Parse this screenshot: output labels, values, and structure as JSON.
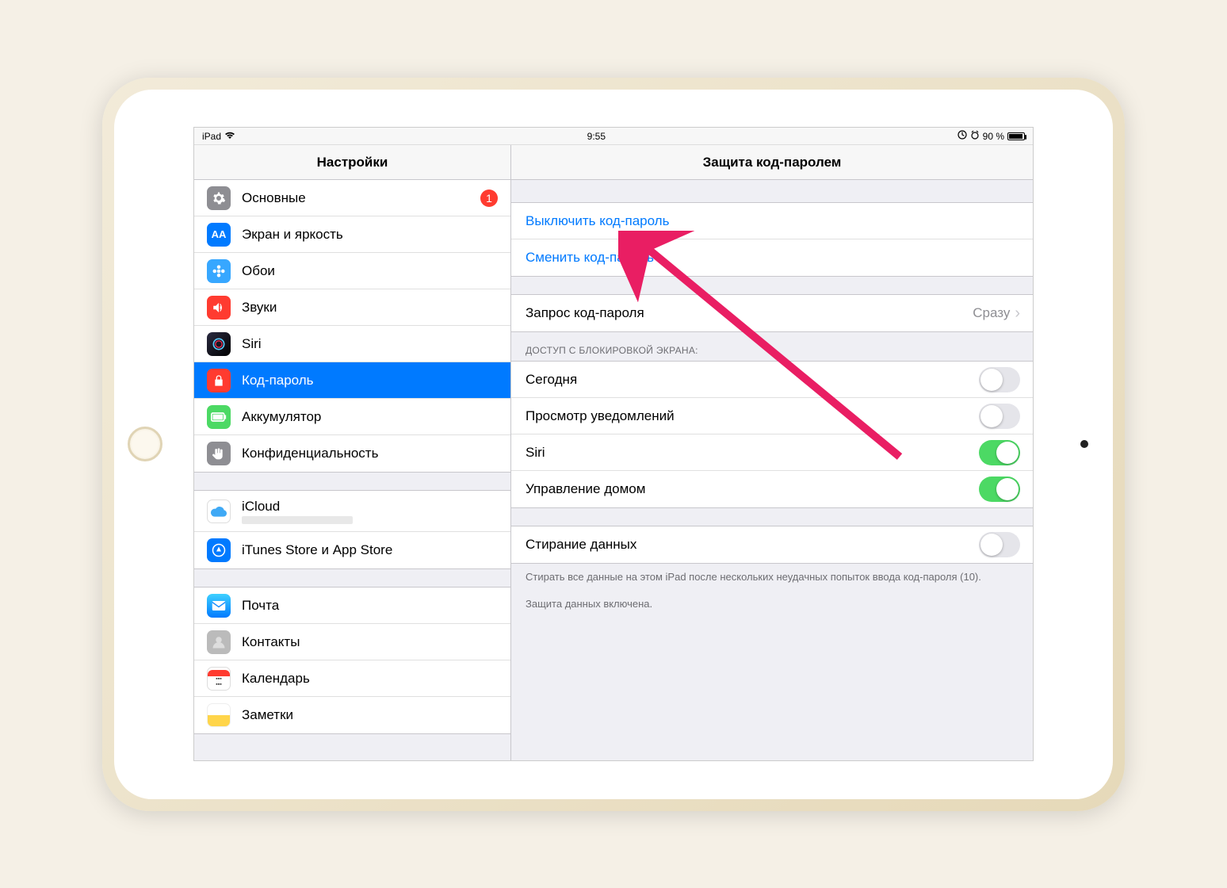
{
  "statusbar": {
    "device": "iPad",
    "time": "9:55",
    "battery_pct": "90 %"
  },
  "sidebar": {
    "title": "Настройки",
    "groups": [
      {
        "items": [
          {
            "id": "general",
            "label": "Основные",
            "badge": "1",
            "icon": "gear",
            "color": "icon-gray"
          },
          {
            "id": "display",
            "label": "Экран и яркость",
            "icon": "AA",
            "color": "icon-blue"
          },
          {
            "id": "wallpaper",
            "label": "Обои",
            "icon": "flower",
            "color": "icon-blue-dark"
          },
          {
            "id": "sounds",
            "label": "Звуки",
            "icon": "speaker",
            "color": "icon-red"
          },
          {
            "id": "siri",
            "label": "Siri",
            "icon": "siri",
            "color": "icon-grad"
          },
          {
            "id": "passcode",
            "label": "Код-пароль",
            "icon": "lock",
            "color": "icon-red",
            "selected": true
          },
          {
            "id": "battery",
            "label": "Аккумулятор",
            "icon": "battery",
            "color": "icon-green"
          },
          {
            "id": "privacy",
            "label": "Конфиденциальность",
            "icon": "hand",
            "color": "icon-gray"
          }
        ]
      },
      {
        "items": [
          {
            "id": "icloud",
            "label": "iCloud",
            "sub": "",
            "icon": "cloud",
            "color": "icon-white"
          },
          {
            "id": "itunes",
            "label": "iTunes Store и App Store",
            "icon": "appstore",
            "color": "icon-blue"
          }
        ]
      },
      {
        "items": [
          {
            "id": "mail",
            "label": "Почта",
            "icon": "mail",
            "color": "icon-blue"
          },
          {
            "id": "contacts",
            "label": "Контакты",
            "icon": "contacts",
            "color": "icon-gray"
          },
          {
            "id": "calendar",
            "label": "Календарь",
            "icon": "calendar",
            "color": "icon-white"
          },
          {
            "id": "notes",
            "label": "Заметки",
            "icon": "notes",
            "color": "icon-yellow"
          }
        ]
      }
    ]
  },
  "detail": {
    "title": "Защита код-паролем",
    "actions": {
      "turn_off": "Выключить код-пароль",
      "change": "Сменить код-пароль"
    },
    "require": {
      "label": "Запрос код-пароля",
      "value": "Сразу"
    },
    "lock_header": "ДОСТУП С БЛОКИРОВКОЙ ЭКРАНА:",
    "lock_items": [
      {
        "id": "today",
        "label": "Сегодня",
        "on": false
      },
      {
        "id": "notifications",
        "label": "Просмотр уведомлений",
        "on": false
      },
      {
        "id": "siri",
        "label": "Siri",
        "on": true
      },
      {
        "id": "home",
        "label": "Управление домом",
        "on": true
      }
    ],
    "erase": {
      "label": "Стирание данных",
      "on": false
    },
    "erase_footer": "Стирать все данные на этом iPad после нескольких неудачных попыток ввода код-пароля (10).",
    "protection_footer": "Защита данных включена."
  }
}
